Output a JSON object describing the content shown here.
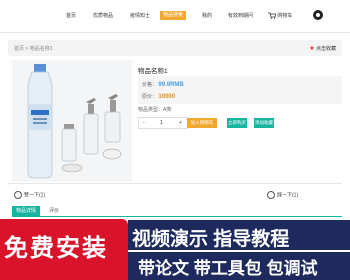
{
  "nav": {
    "items": [
      "首页",
      "优质物品",
      "疫情知士",
      "物品搜索",
      "我的",
      "有效到期问"
    ],
    "active_index": 3,
    "cart_label": "购物车"
  },
  "breadcrumb": {
    "text": "首页 > 物品名称1"
  },
  "favorite": {
    "label": "点击收藏"
  },
  "product": {
    "name": "物品名称1",
    "price_label": "价格：",
    "price_value": "99.9RMB",
    "old_price_label": "原价：",
    "old_price_value": "10000",
    "inventory": "物品类型：A类",
    "quantity": "1",
    "qty_minus": "-",
    "qty_plus": "+",
    "buy_label": "加入购物车",
    "cart_label": "立即购买",
    "more_label": "添加收藏"
  },
  "votes": {
    "up": "赞一下(1)",
    "down": "踩一下(1)"
  },
  "tabs": [
    "物品详情",
    "评价"
  ],
  "promo": {
    "left": "免费安装",
    "right_top": "视频演示 指导教程",
    "right_bottom": "带论文 带工具包 包调试"
  },
  "colors": {
    "accent": "#f0a830",
    "teal": "#17b5a0",
    "price": "#4a9fe0",
    "promo_red": "#d9142a",
    "promo_blue": "#1e2a5e"
  }
}
